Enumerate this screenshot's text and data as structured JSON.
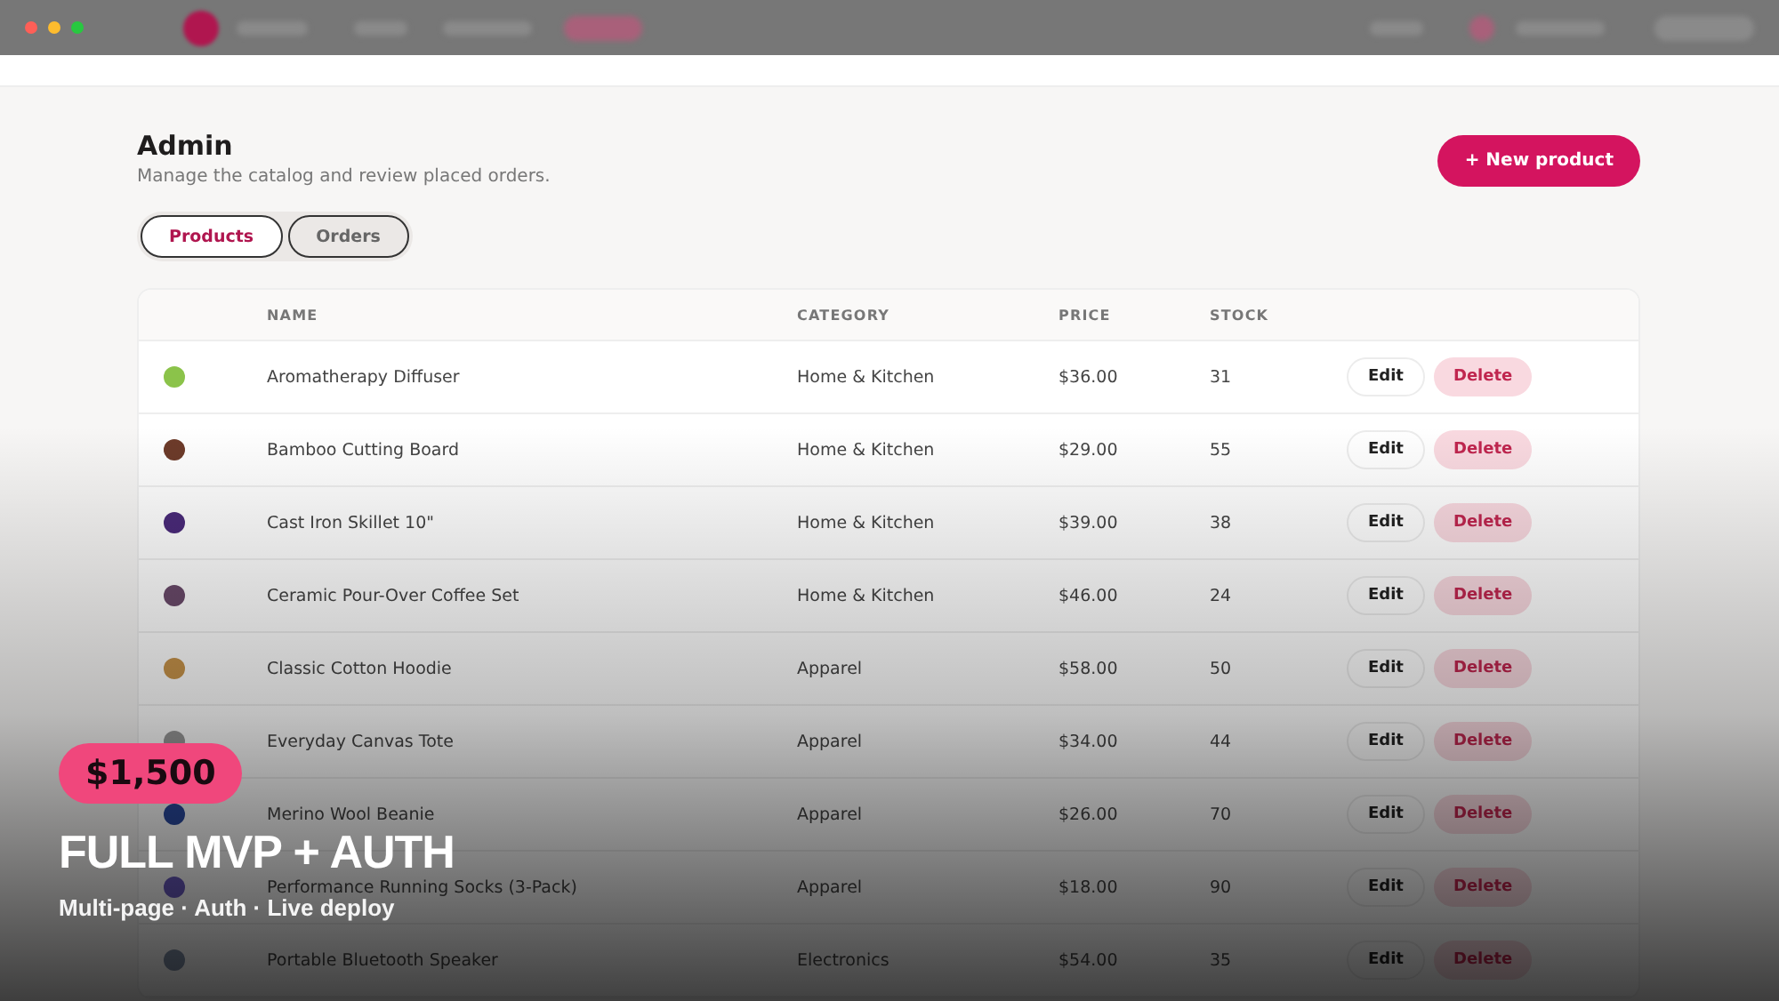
{
  "header": {
    "title": "Admin",
    "subtitle": "Manage the catalog and review placed orders.",
    "action": "+ New product"
  },
  "tabs": [
    {
      "label": "Products",
      "selected": true
    },
    {
      "label": "Orders",
      "selected": false
    }
  ],
  "table": {
    "columns": [
      "NAME",
      "CATEGORY",
      "PRICE",
      "STOCK"
    ],
    "rows": [
      {
        "name": "Aromatherapy Diffuser",
        "category": "Home & Kitchen",
        "price": "$36.00",
        "stock": "31",
        "edit": "Edit",
        "delete": "Delete"
      },
      {
        "name": "Bamboo Cutting Board",
        "category": "Home & Kitchen",
        "price": "$29.00",
        "stock": "55",
        "edit": "Edit",
        "delete": "Delete"
      },
      {
        "name": "Cast Iron Skillet 10\"",
        "category": "Home & Kitchen",
        "price": "$39.00",
        "stock": "38",
        "edit": "Edit",
        "delete": "Delete"
      },
      {
        "name": "Ceramic Pour-Over Coffee Set",
        "category": "Home & Kitchen",
        "price": "$46.00",
        "stock": "24",
        "edit": "Edit",
        "delete": "Delete"
      },
      {
        "name": "Classic Cotton Hoodie",
        "category": "Apparel",
        "price": "$58.00",
        "stock": "50",
        "edit": "Edit",
        "delete": "Delete"
      },
      {
        "name": "Everyday Canvas Tote",
        "category": "Apparel",
        "price": "$34.00",
        "stock": "44",
        "edit": "Edit",
        "delete": "Delete"
      },
      {
        "name": "Merino Wool Beanie",
        "category": "Apparel",
        "price": "$26.00",
        "stock": "70",
        "edit": "Edit",
        "delete": "Delete"
      },
      {
        "name": "Performance Running Socks (3-Pack)",
        "category": "Apparel",
        "price": "$18.00",
        "stock": "90",
        "edit": "Edit",
        "delete": "Delete"
      },
      {
        "name": "Portable Bluetooth Speaker",
        "category": "Electronics",
        "price": "$54.00",
        "stock": "35",
        "edit": "Edit",
        "delete": "Delete"
      }
    ]
  },
  "promo": {
    "price": "$1,500",
    "title": "FULL MVP + AUTH",
    "subtitle": "Multi-page · Auth · Live deploy"
  }
}
